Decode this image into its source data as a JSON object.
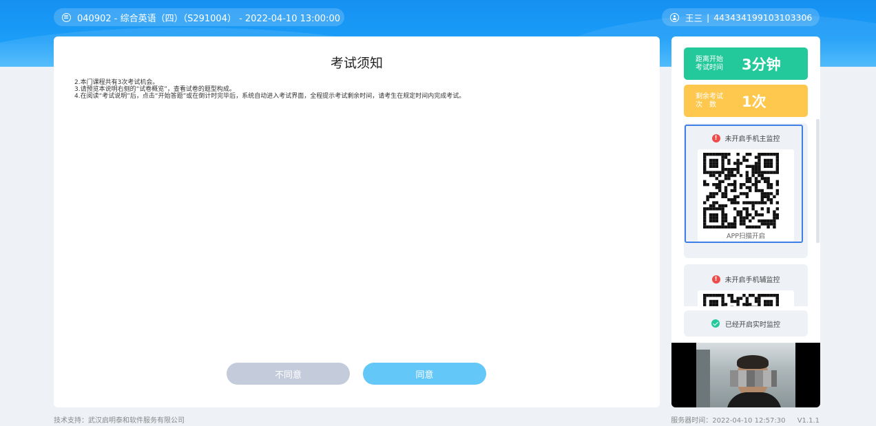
{
  "header": {
    "exam_info": "040902 - 综合英语（四）（S291004） - 2022-04-10 13:00:00",
    "user_name": "王三",
    "separator": "|",
    "user_id": "443434199103103306"
  },
  "main": {
    "title": "考试须知",
    "notice_lines": [
      "2.本门课程共有3次考试机会。",
      "3.请预览本说明右侧的“试卷概览”，查看试卷的题型构成。",
      "4.在阅读“考试说明”后，点击“开始答题”或在倒计时完毕后，系统自动进入考试界面，全程提示考试剩余时间，请考生在规定时间内完成考试。"
    ],
    "disagree_label": "不同意",
    "agree_label": "同意"
  },
  "sidebar": {
    "countdown": {
      "label_line1": "距离开始",
      "label_line2": "考试时间",
      "value": "3分钟",
      "color": "#23c99a"
    },
    "remaining": {
      "label_line1": "剩余考试",
      "label_line2": "次　数",
      "value": "1次",
      "color": "#fec84f"
    },
    "monitor_main": {
      "status": "未开启手机主监控",
      "caption": "APP扫描开启",
      "icon": "warning-icon"
    },
    "monitor_aux": {
      "status": "未开启手机辅监控",
      "icon": "warning-icon"
    },
    "live_monitor": {
      "status": "已经开启实时监控",
      "icon": "check-circle-icon"
    }
  },
  "footer": {
    "support": "技术支持：武汉启明泰和软件服务有限公司",
    "server_time": "服务器时间：2022-04-10 12:57:30",
    "version": "V1.1.1"
  }
}
